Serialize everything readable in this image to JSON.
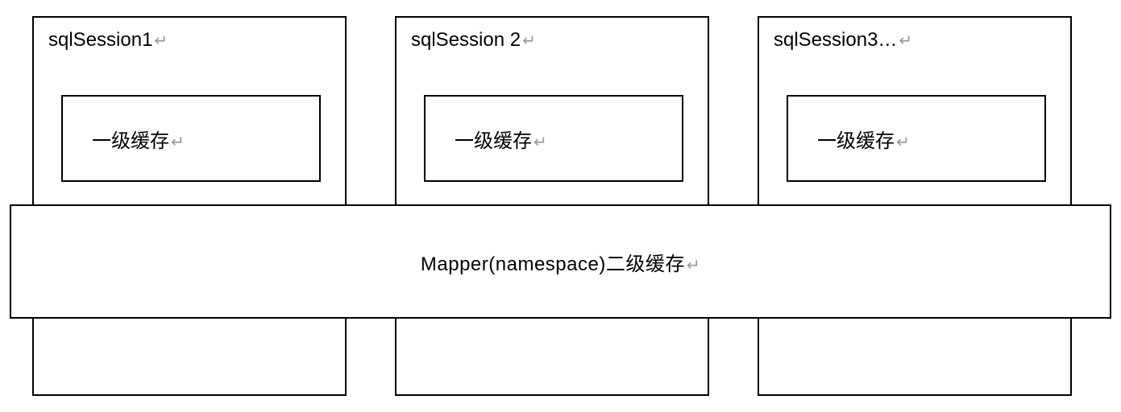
{
  "sessions": [
    {
      "label": "sqlSession1",
      "l1_cache_label": "一级缓存"
    },
    {
      "label": "sqlSession 2",
      "l1_cache_label": "一级缓存"
    },
    {
      "label": "sqlSession3…",
      "l1_cache_label": "一级缓存"
    }
  ],
  "l2_cache_label": "Mapper(namespace)二级缓存",
  "return_mark": "↵"
}
